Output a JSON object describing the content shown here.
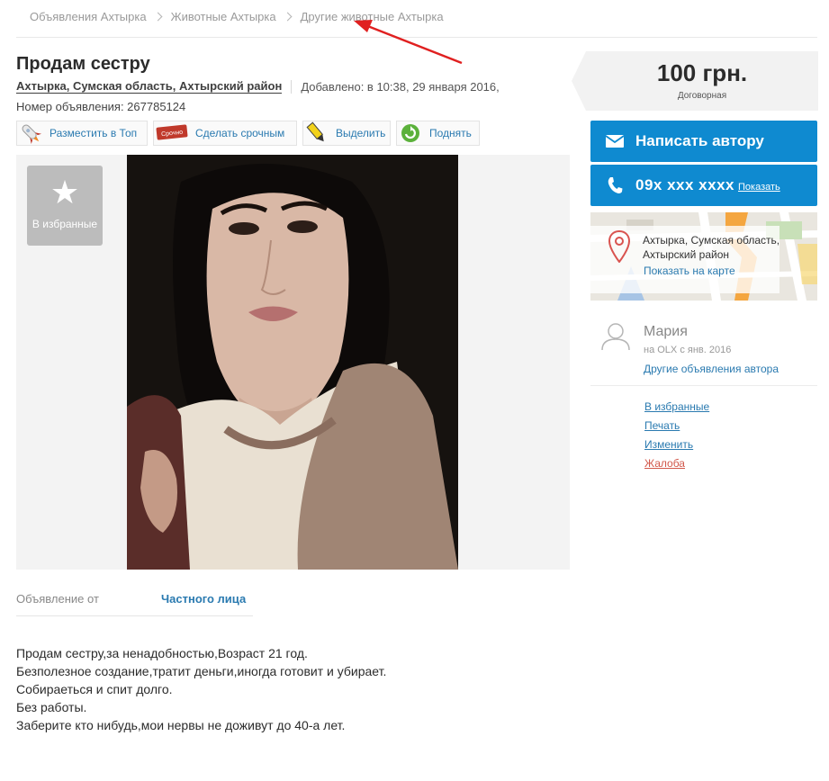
{
  "breadcrumbs": [
    "Объявления Ахтырка",
    "Животные Ахтырка",
    "Другие животные Ахтырка"
  ],
  "ad": {
    "title": "Продам сестру",
    "location": "Ахтырка, Сумская область, Ахтырский район",
    "added": "Добавлено: в 10:38, 29 января 2016,",
    "number": "Номер объявления: 267785124"
  },
  "promo_buttons": [
    {
      "label": "Разместить в Топ",
      "icon": "rocket-icon"
    },
    {
      "label": "Сделать срочным",
      "icon": "urgent-tag-icon",
      "icon_text": "Срочно"
    },
    {
      "label": "Выделить",
      "icon": "marker-icon"
    },
    {
      "label": "Поднять",
      "icon": "refresh-icon"
    }
  ],
  "favorite": {
    "label": "В избранные"
  },
  "details": {
    "from_label": "Объявление от",
    "from_value": "Частного лица"
  },
  "description": [
    "Продам сестру,за ненадобностью,Возраст 21 год.",
    "Безполезное создание,тратит деньги,иногда готовит и убирает.",
    "Собираеться и спит долго.",
    "Без работы.",
    "Заберите кто нибудь,мои нервы не доживут до 40-а лет."
  ],
  "price": {
    "amount": "100 грн.",
    "note": "Договорная"
  },
  "contact": {
    "write_label": "Написать автору",
    "phone": "09x xxx xxxx",
    "show_label": "Показать"
  },
  "map": {
    "address_line1": "Ахтырка, Сумская область,",
    "address_line2": "Ахтырский район",
    "link": "Показать на карте"
  },
  "seller": {
    "name": "Мария",
    "since": "на OLX с янв. 2016",
    "other_ads": "Другие объявления автора"
  },
  "actions": [
    "В избранные",
    "Печать",
    "Изменить",
    "Жалоба"
  ],
  "colors": {
    "accent": "#0f8ad0",
    "link": "#2a7ab0",
    "complaint": "#d2584b",
    "arrow": "#e02020"
  }
}
